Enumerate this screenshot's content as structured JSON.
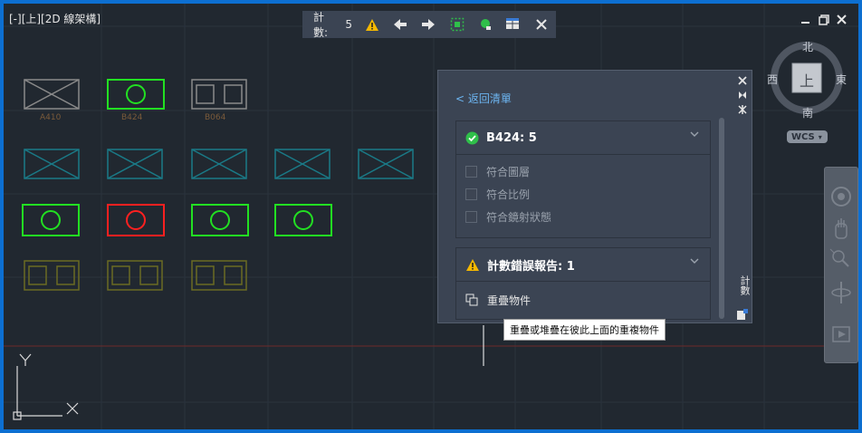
{
  "viewport": {
    "label": "[-][上][2D 線架構]"
  },
  "toolbar": {
    "count_label": "計數:",
    "count_value": "5",
    "icons": [
      "warning-icon",
      "arrow-left-icon",
      "arrow-right-icon",
      "select-area-icon",
      "zoom-object-icon",
      "table-insert-icon",
      "close-icon"
    ]
  },
  "window_controls": [
    "minimize-icon",
    "restore-icon",
    "close-icon"
  ],
  "palette": {
    "back_link": "< 返回清單",
    "section1": {
      "title": "B424: 5",
      "status_color": "#2fbf4a",
      "checks": [
        "符合圖層",
        "符合比例",
        "符合鏡射狀態"
      ]
    },
    "section2": {
      "title": "計數錯誤報告: 1",
      "status_color": "#f5b800",
      "item": "重疊物件"
    },
    "side_title": "計數"
  },
  "tooltip": "重疊或堆疊在彼此上面的重複物件",
  "blocks": {
    "labels": [
      "A410",
      "B424",
      "B064"
    ]
  },
  "compass": {
    "north": "北",
    "south": "南",
    "east": "東",
    "west": "西",
    "center": "上",
    "wcs": "WCS"
  },
  "colors": {
    "accent_green": "#22e022",
    "accent_red": "#ff2020",
    "cyan": "#1a7a87",
    "olive": "#6b6b22",
    "gray": "#8a8a8a"
  }
}
